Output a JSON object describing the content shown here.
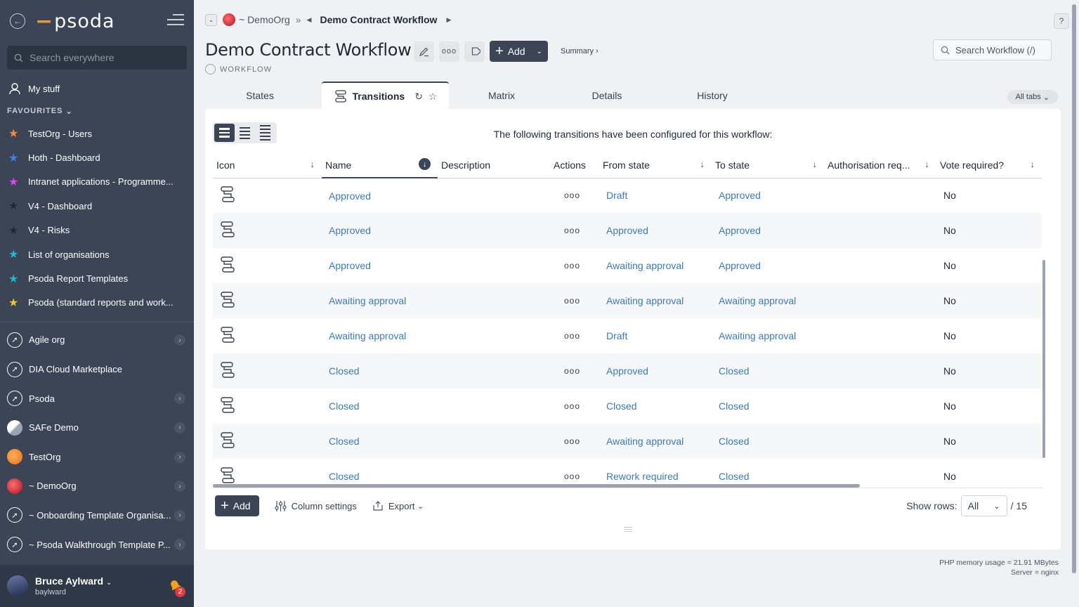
{
  "sidebar": {
    "logo_text": "psoda",
    "search_placeholder": "Search everywhere",
    "my_stuff": "My stuff",
    "favourites_label": "FAVOURITES",
    "favourites": [
      {
        "label": "TestOrg - Users",
        "color": "#f58a3c"
      },
      {
        "label": "Hoth - Dashboard",
        "color": "#3b82f6"
      },
      {
        "label": "Intranet applications - Programme...",
        "color": "#d946ef"
      },
      {
        "label": "V4 - Dashboard",
        "color": "#1f2937"
      },
      {
        "label": "V4 - Risks",
        "color": "#1f2937"
      },
      {
        "label": "List of organisations",
        "color": "#22b8cf"
      },
      {
        "label": "Psoda Report Templates",
        "color": "#22b8cf"
      },
      {
        "label": "Psoda (standard reports and work...",
        "color": "#f2c12e"
      }
    ],
    "orgs": [
      {
        "label": "Agile org",
        "chevron": true
      },
      {
        "label": "DIA Cloud Marketplace",
        "chevron": false
      },
      {
        "label": "Psoda",
        "chevron": true
      },
      {
        "label": "SAFe Demo",
        "chevron": true
      },
      {
        "label": "TestOrg",
        "chevron": true
      },
      {
        "label": "~ DemoOrg",
        "chevron": true
      },
      {
        "label": "~ Onboarding Template Organisa...",
        "chevron": true
      },
      {
        "label": "~ Psoda Walkthrough Template P...",
        "chevron": true
      }
    ],
    "user": {
      "name": "Bruce Aylward",
      "handle": "baylward",
      "notifications": "2"
    }
  },
  "breadcrumb": {
    "org": "~ DemoOrg",
    "separator": "»",
    "current": "Demo Contract Workflow"
  },
  "page": {
    "title": "Demo Contract Workflow",
    "type_label": "WORKFLOW",
    "add_label": "Add",
    "summary_link": "Summary ›",
    "search_placeholder": "Search Workflow (/)",
    "help": "?"
  },
  "tabs": {
    "items": [
      "States",
      "Transitions",
      "Matrix",
      "Details",
      "History"
    ],
    "active": "Transitions",
    "all_tabs": "All tabs"
  },
  "table": {
    "intro": "The following transitions have been configured for this workflow:",
    "columns": [
      "Icon",
      "Name",
      "Description",
      "Actions",
      "From state",
      "To state",
      "Authorisation req...",
      "Vote required?"
    ],
    "rows": [
      {
        "name": "Approved",
        "description": "",
        "from": "Draft",
        "to": "Approved",
        "auth": "",
        "vote": "No"
      },
      {
        "name": "Approved",
        "description": "",
        "from": "Approved",
        "to": "Approved",
        "auth": "",
        "vote": "No"
      },
      {
        "name": "Approved",
        "description": "",
        "from": "Awaiting approval",
        "to": "Approved",
        "auth": "",
        "vote": "No"
      },
      {
        "name": "Awaiting approval",
        "description": "",
        "from": "Awaiting approval",
        "to": "Awaiting approval",
        "auth": "",
        "vote": "No"
      },
      {
        "name": "Awaiting approval",
        "description": "",
        "from": "Draft",
        "to": "Awaiting approval",
        "auth": "",
        "vote": "No"
      },
      {
        "name": "Closed",
        "description": "",
        "from": "Approved",
        "to": "Closed",
        "auth": "",
        "vote": "No"
      },
      {
        "name": "Closed",
        "description": "",
        "from": "Closed",
        "to": "Closed",
        "auth": "",
        "vote": "No"
      },
      {
        "name": "Closed",
        "description": "",
        "from": "Awaiting approval",
        "to": "Closed",
        "auth": "",
        "vote": "No"
      },
      {
        "name": "Closed",
        "description": "",
        "from": "Rework required",
        "to": "Closed",
        "auth": "",
        "vote": "No"
      }
    ],
    "actions_glyph": "ooo"
  },
  "bottom": {
    "add": "Add",
    "column_settings": "Column settings",
    "export": "Export",
    "show_rows_label": "Show rows:",
    "show_rows_value": "All",
    "total": "/ 15"
  },
  "footer": {
    "memory": "PHP memory usage = 21.91 MBytes",
    "server": "Server = nginx"
  }
}
